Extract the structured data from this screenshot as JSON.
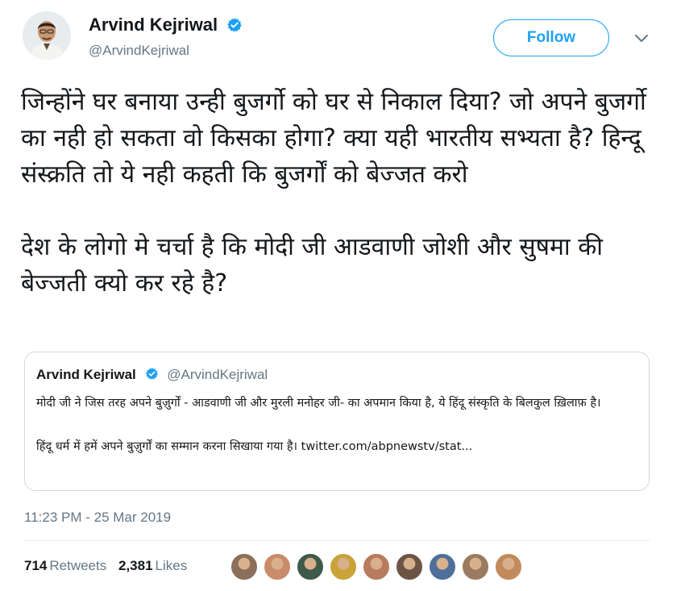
{
  "author": {
    "name": "Arvind Kejriwal",
    "handle": "@ArvindKejriwal",
    "verified": true,
    "avatar_icon": "profile-photo"
  },
  "follow_label": "Follow",
  "menu_icon": "chevron-down-icon",
  "tweet": {
    "paragraphs": [
      "जिन्होंने घर बनाया उन्ही बुजर्गो को घर से निकाल दिया? जो अपने बुजर्गो का नही हो सकता वो किसका होगा? क्या यही भारतीय सभ्यता है? हिन्दू संस्क्रति तो ये नही कहती कि बुजर्गों को बेज्जत करो",
      "देश के लोगो मे चर्चा है कि मोदी जी आडवाणी जोशी और सुषमा की बेज्जती क्यो कर रहे है?"
    ]
  },
  "quoted": {
    "name": "Arvind Kejriwal",
    "handle": "@ArvindKejriwal",
    "paragraphs": [
      "मोदी जी ने जिस तरह अपने बुज़ुर्गों - आडवाणी जी और मुरली मनोहर जी- का अपमान किया है, ये हिंदू संस्कृति के बिलकुल ख़िलाफ़ है।",
      "हिंदू धर्म में हमें अपने बुज़ुर्गों का सम्मान करना सिखाया गया है। twitter.com/abpnewstv/stat..."
    ]
  },
  "timestamp": "11:23 PM - 25 Mar 2019",
  "stats": {
    "retweets_count": "714",
    "retweets_label": "Retweets",
    "likes_count": "2,381",
    "likes_label": "Likes"
  },
  "colors": {
    "accent": "#1da1f2",
    "secondary_text": "#657786",
    "border": "#cfd9de"
  },
  "liker_avatars": [
    "#8a6f5a",
    "#c98c6b",
    "#3d5a4a",
    "#c9a33a",
    "#b87b5e",
    "#6b5446",
    "#4f6f9a",
    "#9a7b5f",
    "#c28a5c"
  ]
}
